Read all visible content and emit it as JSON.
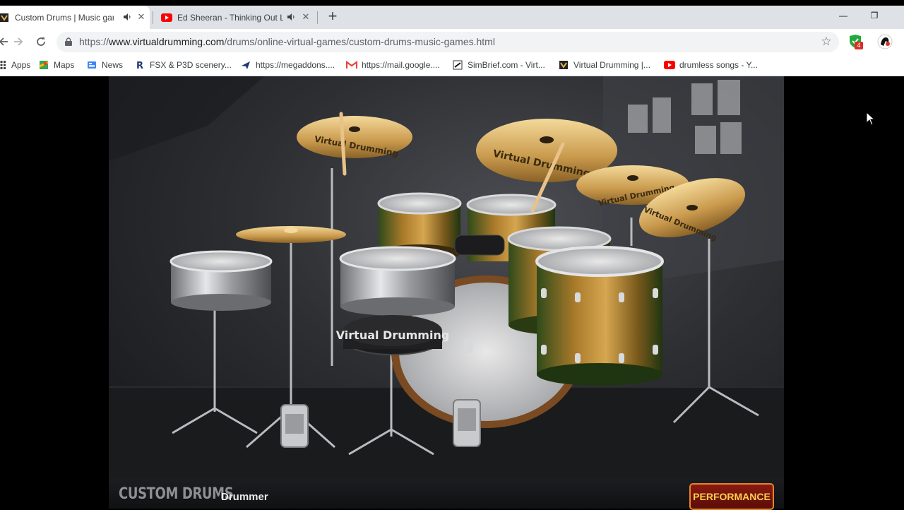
{
  "browser": {
    "tabs": [
      {
        "title": "Custom Drums | Music games",
        "active": true,
        "audio": true,
        "favicon": "virtual-drumming-favicon"
      },
      {
        "title": "Ed Sheeran - Thinking Out Loud",
        "active": false,
        "audio": true,
        "favicon": "youtube-favicon"
      }
    ],
    "new_tab_label": "+",
    "window": {
      "minimize": "—",
      "restore": "❐"
    },
    "url": {
      "scheme": "https://",
      "host": "www.virtualdrumming.com",
      "path": "/drums/online-virtual-games/custom-drums-music-games.html"
    },
    "extension_badge": "4",
    "bookmarks": [
      {
        "label": "Apps",
        "icon": "apps-grid-icon"
      },
      {
        "label": "Maps",
        "icon": "maps-icon"
      },
      {
        "label": "News",
        "icon": "news-icon"
      },
      {
        "label": "FSX & P3D scenery...",
        "icon": "r-logo-icon"
      },
      {
        "label": "https://megaddons....",
        "icon": "plane-icon"
      },
      {
        "label": "https://mail.google....",
        "icon": "gmail-icon"
      },
      {
        "label": "SimBrief.com - Virt...",
        "icon": "simbrief-icon"
      },
      {
        "label": "Virtual Drumming |...",
        "icon": "virtual-drumming-icon"
      },
      {
        "label": "drumless songs - Y...",
        "icon": "youtube-icon"
      }
    ]
  },
  "page": {
    "kit_brand": "Virtual Drumming",
    "footer": {
      "title": "CUSTOM DRUMS",
      "mode_label": "Drummer",
      "performance_button": "PERFORMANCE"
    }
  },
  "colors": {
    "accent_orange": "#e3862a",
    "button_red": "#8a1a10",
    "button_text": "#ffd04a",
    "youtube_red": "#ff0000"
  }
}
